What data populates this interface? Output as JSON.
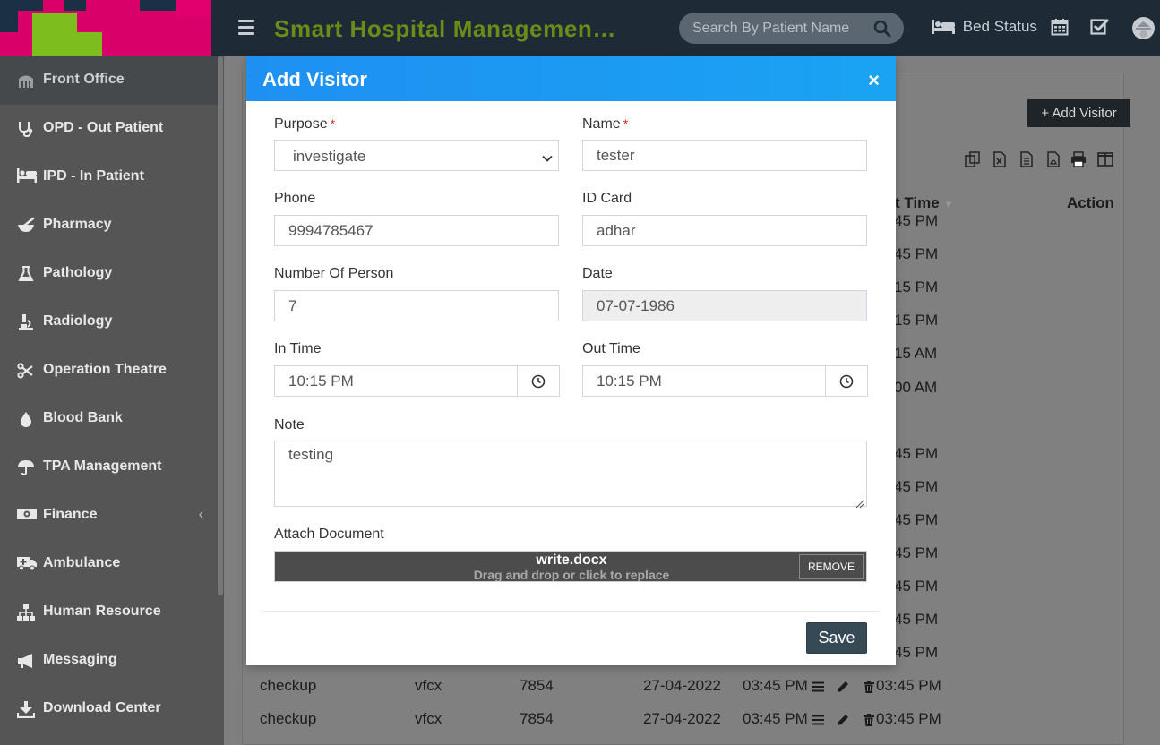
{
  "header": {
    "app_title": "Smart Hospital Managemen…",
    "search_placeholder": "Search By Patient Name",
    "bed_status_label": "Bed Status"
  },
  "sidebar": {
    "items": [
      {
        "label": "Front Office",
        "icon": "building-icon",
        "active": true
      },
      {
        "label": "OPD - Out Patient",
        "icon": "stethoscope-icon"
      },
      {
        "label": "IPD - In Patient",
        "icon": "bed-icon"
      },
      {
        "label": "Pharmacy",
        "icon": "mortar-pestle-icon"
      },
      {
        "label": "Pathology",
        "icon": "flask-icon"
      },
      {
        "label": "Radiology",
        "icon": "microscope-icon"
      },
      {
        "label": "Operation Theatre",
        "icon": "scissors-icon"
      },
      {
        "label": "Blood Bank",
        "icon": "drop-icon"
      },
      {
        "label": "TPA Management",
        "icon": "umbrella-icon"
      },
      {
        "label": "Finance",
        "icon": "money-icon",
        "chevron": "‹"
      },
      {
        "label": "Ambulance",
        "icon": "ambulance-icon"
      },
      {
        "label": "Human Resource",
        "icon": "sitemap-icon"
      },
      {
        "label": "Messaging",
        "icon": "bullhorn-icon"
      },
      {
        "label": "Download Center",
        "icon": "download-icon"
      }
    ]
  },
  "background_table": {
    "add_button_label": "+ Add Visitor",
    "headers": {
      "out_time": "t Time",
      "action": "Action"
    },
    "out_times": [
      "45 PM",
      "45 PM",
      "15 PM",
      "15 PM",
      "15 AM",
      "00 AM",
      "",
      "45 PM",
      "45 PM",
      "45 PM",
      "45 PM",
      "45 PM",
      "45 PM",
      "45 PM"
    ],
    "rows": [
      {
        "purpose": "checkup",
        "name": "vfcx",
        "phone": "7854",
        "date": "27-04-2022",
        "in_time": "03:45 PM",
        "out_time": "03:45 PM"
      },
      {
        "purpose": "checkup",
        "name": "vfcx",
        "phone": "7854",
        "date": "27-04-2022",
        "in_time": "03:45 PM",
        "out_time": "03:45 PM"
      }
    ]
  },
  "modal": {
    "title": "Add Visitor",
    "close_symbol": "×",
    "purpose": {
      "label": "Purpose",
      "required": "*",
      "value": "investigate"
    },
    "name": {
      "label": "Name",
      "required": "*",
      "value": "tester"
    },
    "phone": {
      "label": "Phone",
      "value": "9994785467"
    },
    "id_card": {
      "label": "ID Card",
      "value": "adhar"
    },
    "number_of_person": {
      "label": "Number Of Person",
      "value": "7"
    },
    "date": {
      "label": "Date",
      "value": "07-07-1986"
    },
    "in_time": {
      "label": "In Time",
      "value": "10:15 PM"
    },
    "out_time": {
      "label": "Out Time",
      "value": "10:15 PM"
    },
    "note": {
      "label": "Note",
      "value": "testing"
    },
    "attach": {
      "label": "Attach Document",
      "file_name": "write.docx",
      "hint": "Drag and drop or click to replace",
      "remove_label": "REMOVE"
    },
    "save_label": "Save"
  },
  "colors": {
    "modal_header": "#1e90f2",
    "topbar": "#1e2a36",
    "title_green": "#6e8b1a",
    "save_button": "#364a55",
    "required_star": "#e2231a"
  }
}
